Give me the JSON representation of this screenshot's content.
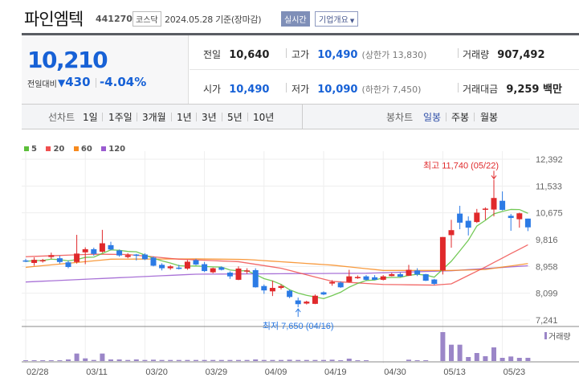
{
  "header": {
    "title": "파인엠텍",
    "code": "441270",
    "market": "코스닥",
    "date": "2024.05.28 기준(장마감)",
    "realtime_label": "실시간",
    "company_info_label": "기업개요"
  },
  "quote": {
    "price": "10,210",
    "change_label": "전일대비",
    "change": "430",
    "change_pct": "-4.04%",
    "direction": "down",
    "prev_close_label": "전일",
    "prev_close": "10,640",
    "open_label": "시가",
    "open": "10,490",
    "high_label": "고가",
    "high": "10,490",
    "upper_limit": "(상한가 13,830)",
    "low_label": "저가",
    "low": "10,090",
    "lower_limit": "(하한가 7,450)",
    "volume_label": "거래량",
    "volume": "907,492",
    "amount_label": "거래대금",
    "amount": "9,259 백만"
  },
  "toolbar": {
    "line_chart_label": "선차트",
    "line_periods": [
      "1일",
      "1주일",
      "3개월",
      "1년",
      "3년",
      "5년",
      "10년"
    ],
    "candle_chart_label": "봉차트",
    "candle_periods": [
      "일봉",
      "주봉",
      "월봉"
    ],
    "active_candle": "일봉"
  },
  "colors": {
    "up": "#e0292b",
    "down": "#2c7be5",
    "ma5": "#5cbf3a",
    "ma20": "#f0504f",
    "ma60": "#f78a1d",
    "ma120": "#9a5bd0",
    "volume": "#9b86c8"
  },
  "chart_data": {
    "type": "candlestick",
    "legend": [
      "5",
      "20",
      "60",
      "120"
    ],
    "y_ticks": [
      "12,392",
      "11,533",
      "10,675",
      "9,816",
      "8,958",
      "8,099",
      "7,241"
    ],
    "ylim": [
      7241,
      12392
    ],
    "x_ticks": [
      {
        "i": 0,
        "label": "02/28"
      },
      {
        "i": 7,
        "label": "03/11"
      },
      {
        "i": 14,
        "label": "03/20"
      },
      {
        "i": 21,
        "label": "03/29"
      },
      {
        "i": 28,
        "label": "04/09"
      },
      {
        "i": 35,
        "label": "04/19"
      },
      {
        "i": 42,
        "label": "04/30"
      },
      {
        "i": 49,
        "label": "05/13"
      },
      {
        "i": 56,
        "label": "05/23"
      }
    ],
    "ohlc": [
      [
        9150,
        9200,
        9100,
        9120
      ],
      [
        9070,
        9250,
        8980,
        9170
      ],
      [
        9120,
        9200,
        9080,
        9160
      ],
      [
        9260,
        9400,
        9200,
        9320
      ],
      [
        9220,
        9300,
        9050,
        9100
      ],
      [
        9090,
        9150,
        8900,
        8940
      ],
      [
        9100,
        9970,
        9050,
        9370
      ],
      [
        9410,
        9570,
        9030,
        9510
      ],
      [
        9510,
        9560,
        9300,
        9360
      ],
      [
        9430,
        10130,
        9400,
        9700
      ],
      [
        9640,
        9750,
        9480,
        9500
      ],
      [
        9470,
        9500,
        9270,
        9310
      ],
      [
        9260,
        9380,
        9220,
        9320
      ],
      [
        9340,
        9360,
        9150,
        9300
      ],
      [
        9340,
        9380,
        9160,
        9190
      ],
      [
        9240,
        9280,
        8960,
        8980
      ],
      [
        9010,
        9060,
        8830,
        8900
      ],
      [
        8900,
        9000,
        8850,
        8960
      ],
      [
        8920,
        9010,
        8860,
        8880
      ],
      [
        8890,
        9160,
        8850,
        9110
      ],
      [
        9160,
        9200,
        9000,
        9020
      ],
      [
        9030,
        9100,
        8780,
        8810
      ],
      [
        8770,
        8920,
        8740,
        8900
      ],
      [
        8930,
        8960,
        8830,
        8850
      ],
      [
        8760,
        8800,
        8560,
        8640
      ],
      [
        8530,
        8960,
        8520,
        8890
      ],
      [
        8800,
        8900,
        8720,
        8830
      ],
      [
        8840,
        8900,
        8280,
        8290
      ],
      [
        8330,
        8380,
        8080,
        8190
      ],
      [
        8160,
        8500,
        8010,
        8270
      ],
      [
        8270,
        8380,
        8220,
        8330
      ],
      [
        8180,
        8220,
        7940,
        7980
      ],
      [
        7870,
        7960,
        7650,
        7750
      ],
      [
        7770,
        7860,
        7740,
        7830
      ],
      [
        7760,
        8060,
        7750,
        8020
      ],
      [
        8130,
        8160,
        8040,
        8060
      ],
      [
        8410,
        8520,
        8340,
        8460
      ],
      [
        8440,
        8480,
        8270,
        8290
      ],
      [
        8460,
        8850,
        8440,
        8640
      ],
      [
        8580,
        8670,
        8560,
        8620
      ],
      [
        8640,
        8680,
        8500,
        8530
      ],
      [
        8610,
        8680,
        8520,
        8530
      ],
      [
        8530,
        8680,
        8510,
        8640
      ],
      [
        8650,
        8750,
        8640,
        8710
      ],
      [
        8710,
        8760,
        8620,
        8630
      ],
      [
        8660,
        9010,
        8650,
        8850
      ],
      [
        8830,
        8900,
        8650,
        8700
      ],
      [
        8710,
        8720,
        8490,
        8500
      ],
      [
        8540,
        8560,
        8360,
        8400
      ],
      [
        8830,
        9900,
        8700,
        9900
      ],
      [
        9960,
        10450,
        9560,
        10120
      ],
      [
        10650,
        10900,
        10150,
        10360
      ],
      [
        10420,
        10560,
        9950,
        10200
      ],
      [
        10380,
        10800,
        10350,
        10680
      ],
      [
        10780,
        10850,
        10450,
        10810
      ],
      [
        10780,
        11740,
        10560,
        11150
      ],
      [
        11060,
        11360,
        10750,
        10770
      ],
      [
        10580,
        10640,
        10100,
        10510
      ],
      [
        10470,
        10680,
        10200,
        10660
      ],
      [
        10490,
        10490,
        10090,
        10210
      ]
    ],
    "volume": [
      225000,
      225000,
      225000,
      225000,
      225000,
      450000,
      2100000,
      750000,
      300000,
      2100000,
      450000,
      450000,
      300000,
      450000,
      300000,
      375000,
      300000,
      300000,
      300000,
      300000,
      300000,
      300000,
      300000,
      300000,
      300000,
      300000,
      300000,
      450000,
      300000,
      300000,
      300000,
      375000,
      300000,
      300000,
      300000,
      300000,
      375000,
      225000,
      675000,
      225000,
      225000,
      0,
      0,
      0,
      0,
      375000,
      225000,
      225000,
      0,
      8100000,
      4575000,
      4575000,
      1125000,
      2250000,
      1350000,
      3825000,
      900000,
      1275000,
      900000,
      907492
    ],
    "volume_label": "거래량",
    "ma20": [
      [
        0,
        9270
      ],
      [
        8,
        9350
      ],
      [
        12,
        9340
      ],
      [
        18,
        9190
      ],
      [
        25,
        9110
      ],
      [
        30,
        8900
      ],
      [
        36,
        8480
      ],
      [
        42,
        8380
      ],
      [
        48,
        8360
      ],
      [
        50,
        8400
      ],
      [
        54,
        8940
      ],
      [
        57,
        9370
      ],
      [
        59,
        9650
      ]
    ],
    "ma60": [
      [
        0,
        8930
      ],
      [
        10,
        9190
      ],
      [
        20,
        9200
      ],
      [
        26,
        9180
      ],
      [
        36,
        9000
      ],
      [
        42,
        8830
      ],
      [
        50,
        8830
      ],
      [
        54,
        8860
      ],
      [
        59,
        9050
      ]
    ],
    "ma120": [
      [
        0,
        8460
      ],
      [
        20,
        8710
      ],
      [
        40,
        8740
      ],
      [
        50,
        8820
      ],
      [
        59,
        8980
      ]
    ],
    "high_annotation": "최고 11,740 (05/22)",
    "high_index": 55,
    "high_value": 11740,
    "low_annotation": "최저 7,650 (04/16)",
    "low_index": 32,
    "low_value": 7650
  }
}
